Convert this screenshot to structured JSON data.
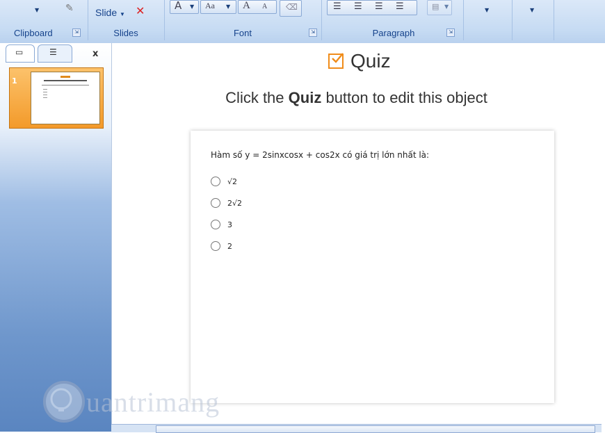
{
  "ribbon": {
    "groups": {
      "clipboard": "Clipboard",
      "slides": "Slides",
      "font": "Font",
      "paragraph": "Paragraph"
    },
    "slide_button": "Slide",
    "font_buttons": [
      "Aa",
      "A",
      "A"
    ]
  },
  "slides_panel": {
    "close": "x",
    "slide_number": "1"
  },
  "slide": {
    "quiz_title": "Quiz",
    "instruction_prefix": "Click the",
    "instruction_bold": "Quiz",
    "instruction_suffix": "button to edit this object",
    "question": "Hàm số y = 2sinxcosx + cos2x có giá trị lớn nhất là:",
    "options": [
      "√2",
      "2√2",
      "3",
      "2"
    ]
  },
  "watermark": {
    "text": "uantrimang"
  },
  "colors": {
    "accent": "#f08c1a",
    "ribbon": "#c6dbf3",
    "slide_selected": "#f39a2a"
  }
}
